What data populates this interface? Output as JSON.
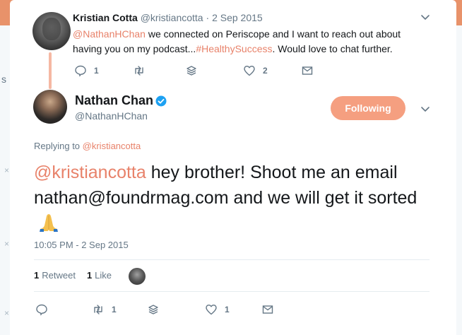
{
  "parent_tweet": {
    "name": "Kristian Cotta",
    "handle": "@kristiancotta",
    "separator": " · ",
    "date": "2 Sep 2015",
    "text_mention": "@NathanHChan",
    "text_part1": " we connected on Periscope and I want to reach out about having you on my podcast...",
    "text_hashtag": "#HealthySuccess",
    "text_part2": ". Would love to chat further.",
    "reply_count": "1",
    "like_count": "2"
  },
  "main_tweet": {
    "name": "Nathan Chan",
    "handle": "@NathanHChan",
    "follow_label": "Following",
    "replying_prefix": "Replying to ",
    "replying_to": "@kristiancotta",
    "text_mention": "@kristiancotta",
    "text_body": " hey brother! Shoot me an email nathan@foundrmag.com and we will get it sorted",
    "emoji": "folded-hands-emoji",
    "timestamp": "10:05 PM - 2 Sep 2015",
    "retweet_count": "1",
    "retweet_label": "Retweet",
    "like_stat_count": "1",
    "like_label": "Like",
    "action_retweet_count": "1",
    "action_like_count": "1"
  },
  "colors": {
    "accent": "#e8826a",
    "follow_button": "#f59f80",
    "verified": "#1da1f2",
    "muted": "#657786"
  },
  "icons": [
    "reply-icon",
    "retweet-icon",
    "stack-icon",
    "heart-icon",
    "mail-icon",
    "chevron-down-icon",
    "verified-badge-icon"
  ]
}
